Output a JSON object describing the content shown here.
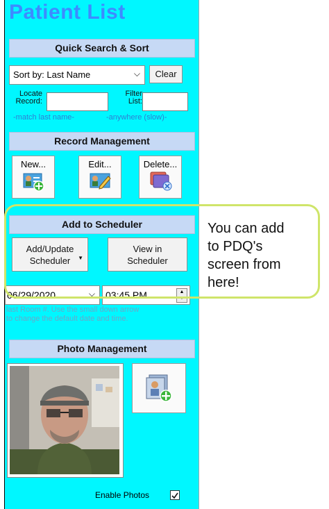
{
  "title": "Patient List",
  "sections": {
    "quick_search": "Quick Search & Sort",
    "record_management": "Record Management",
    "add_to_scheduler": "Add to Scheduler",
    "photo_management": "Photo Management"
  },
  "quick_search": {
    "sort_value": "Sort by: Last Name",
    "clear_label": "Clear",
    "locate_label_1": "Locate",
    "locate_label_2": "Record:",
    "filter_label_1": "Filter",
    "filter_label_2": "List:",
    "hint_locate": "-match last name-",
    "hint_filter": "-anywhere (slow)-"
  },
  "record_buttons": {
    "new": "New...",
    "edit": "Edit...",
    "delete": "Delete..."
  },
  "scheduler": {
    "add_update_1": "Add/Update",
    "add_update_2": "Scheduler",
    "view_1": "View in",
    "view_2": "Scheduler",
    "date_value": "06/29/2020",
    "time_value": "03:45 PM",
    "hint_line_1": "last Room #. Use the small down arrow",
    "hint_line_2": "to change the default date and time."
  },
  "callout": {
    "line1": "You can add",
    "line2": "to PDQ's",
    "line3": "screen from",
    "line4": "here!"
  },
  "photos": {
    "enable_label": "Enable Photos",
    "enabled": true
  },
  "colors": {
    "panel_bg": "#00f7ff",
    "title": "#3d8bff",
    "section_header": "#c6d9f5",
    "callout_border": "#cfe56a"
  }
}
